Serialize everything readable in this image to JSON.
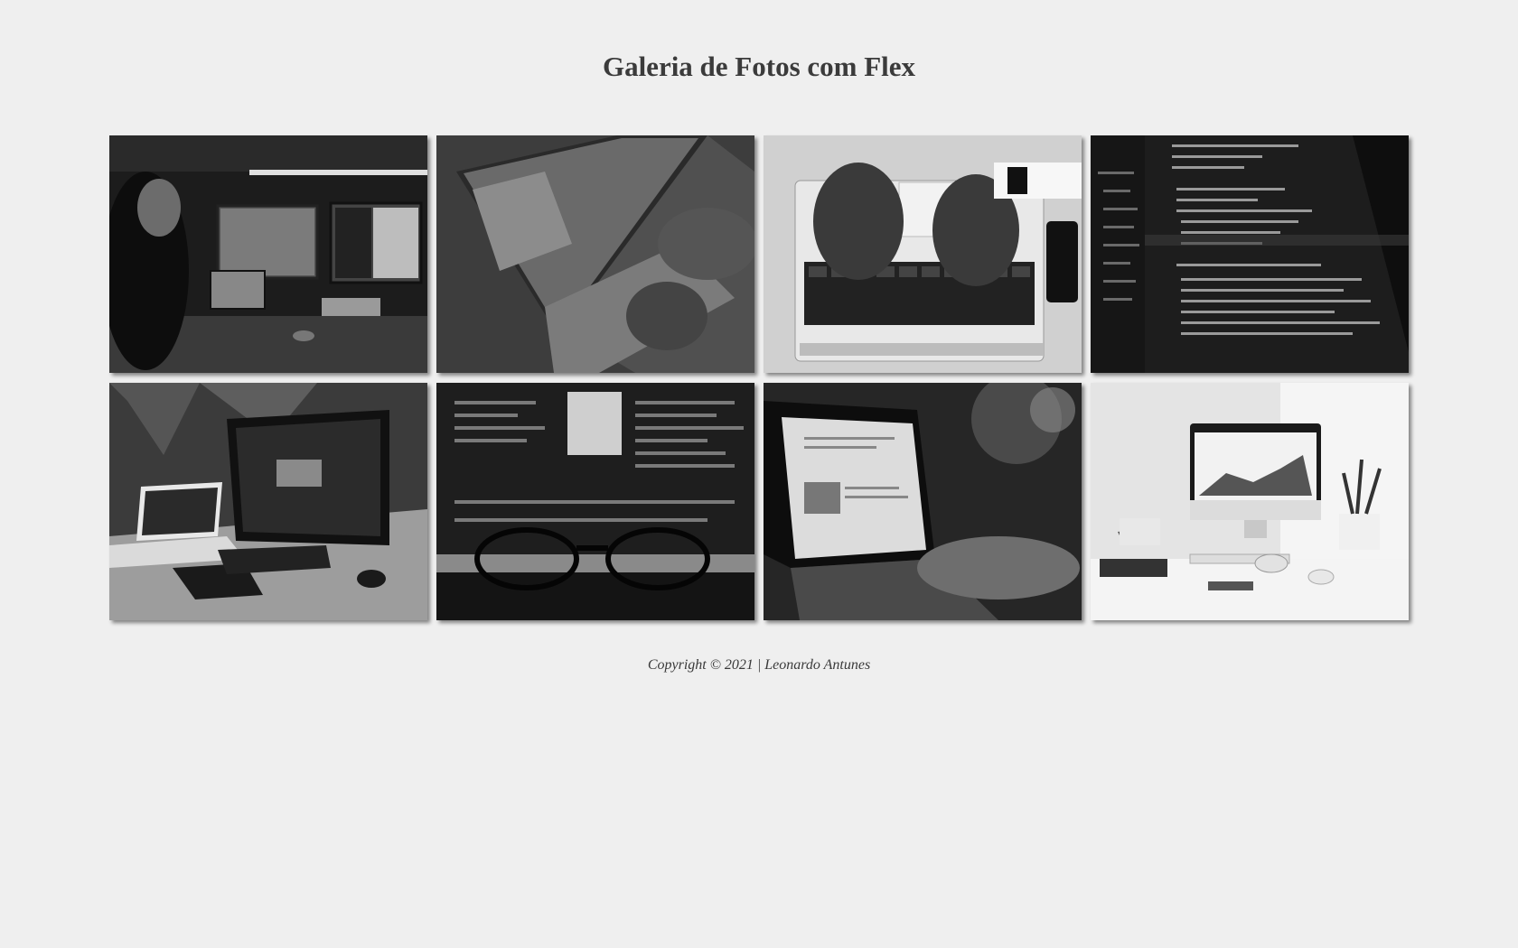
{
  "page": {
    "title": "Galeria de Fotos com Flex",
    "footer": "Copyright © 2021 | Leonardo Antunes"
  },
  "gallery": {
    "photos": [
      {
        "subject": "person-at-dual-monitor-desk"
      },
      {
        "subject": "hands-typing-laptop-code"
      },
      {
        "subject": "hands-on-laptop-keyboard-top-view"
      },
      {
        "subject": "code-editor-screen-closeup"
      },
      {
        "subject": "monitor-and-laptop-open-sign"
      },
      {
        "subject": "glasses-in-front-of-editor"
      },
      {
        "subject": "hand-on-laptop-blog-page"
      },
      {
        "subject": "desktop-computer-white-desk"
      }
    ]
  }
}
